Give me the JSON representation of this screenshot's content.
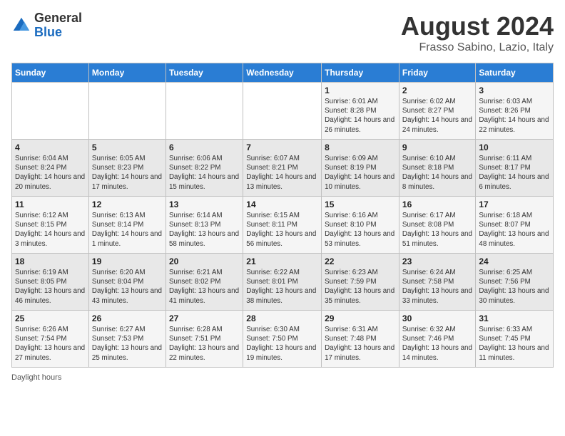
{
  "header": {
    "logo_general": "General",
    "logo_blue": "Blue",
    "month_title": "August 2024",
    "location": "Frasso Sabino, Lazio, Italy"
  },
  "weekdays": [
    "Sunday",
    "Monday",
    "Tuesday",
    "Wednesday",
    "Thursday",
    "Friday",
    "Saturday"
  ],
  "footer": {
    "daylight_note": "Daylight hours"
  },
  "weeks": [
    [
      {
        "day": "",
        "info": ""
      },
      {
        "day": "",
        "info": ""
      },
      {
        "day": "",
        "info": ""
      },
      {
        "day": "",
        "info": ""
      },
      {
        "day": "1",
        "info": "Sunrise: 6:01 AM\nSunset: 8:28 PM\nDaylight: 14 hours and 26 minutes."
      },
      {
        "day": "2",
        "info": "Sunrise: 6:02 AM\nSunset: 8:27 PM\nDaylight: 14 hours and 24 minutes."
      },
      {
        "day": "3",
        "info": "Sunrise: 6:03 AM\nSunset: 8:26 PM\nDaylight: 14 hours and 22 minutes."
      }
    ],
    [
      {
        "day": "4",
        "info": "Sunrise: 6:04 AM\nSunset: 8:24 PM\nDaylight: 14 hours and 20 minutes."
      },
      {
        "day": "5",
        "info": "Sunrise: 6:05 AM\nSunset: 8:23 PM\nDaylight: 14 hours and 17 minutes."
      },
      {
        "day": "6",
        "info": "Sunrise: 6:06 AM\nSunset: 8:22 PM\nDaylight: 14 hours and 15 minutes."
      },
      {
        "day": "7",
        "info": "Sunrise: 6:07 AM\nSunset: 8:21 PM\nDaylight: 14 hours and 13 minutes."
      },
      {
        "day": "8",
        "info": "Sunrise: 6:09 AM\nSunset: 8:19 PM\nDaylight: 14 hours and 10 minutes."
      },
      {
        "day": "9",
        "info": "Sunrise: 6:10 AM\nSunset: 8:18 PM\nDaylight: 14 hours and 8 minutes."
      },
      {
        "day": "10",
        "info": "Sunrise: 6:11 AM\nSunset: 8:17 PM\nDaylight: 14 hours and 6 minutes."
      }
    ],
    [
      {
        "day": "11",
        "info": "Sunrise: 6:12 AM\nSunset: 8:15 PM\nDaylight: 14 hours and 3 minutes."
      },
      {
        "day": "12",
        "info": "Sunrise: 6:13 AM\nSunset: 8:14 PM\nDaylight: 14 hours and 1 minute."
      },
      {
        "day": "13",
        "info": "Sunrise: 6:14 AM\nSunset: 8:13 PM\nDaylight: 13 hours and 58 minutes."
      },
      {
        "day": "14",
        "info": "Sunrise: 6:15 AM\nSunset: 8:11 PM\nDaylight: 13 hours and 56 minutes."
      },
      {
        "day": "15",
        "info": "Sunrise: 6:16 AM\nSunset: 8:10 PM\nDaylight: 13 hours and 53 minutes."
      },
      {
        "day": "16",
        "info": "Sunrise: 6:17 AM\nSunset: 8:08 PM\nDaylight: 13 hours and 51 minutes."
      },
      {
        "day": "17",
        "info": "Sunrise: 6:18 AM\nSunset: 8:07 PM\nDaylight: 13 hours and 48 minutes."
      }
    ],
    [
      {
        "day": "18",
        "info": "Sunrise: 6:19 AM\nSunset: 8:05 PM\nDaylight: 13 hours and 46 minutes."
      },
      {
        "day": "19",
        "info": "Sunrise: 6:20 AM\nSunset: 8:04 PM\nDaylight: 13 hours and 43 minutes."
      },
      {
        "day": "20",
        "info": "Sunrise: 6:21 AM\nSunset: 8:02 PM\nDaylight: 13 hours and 41 minutes."
      },
      {
        "day": "21",
        "info": "Sunrise: 6:22 AM\nSunset: 8:01 PM\nDaylight: 13 hours and 38 minutes."
      },
      {
        "day": "22",
        "info": "Sunrise: 6:23 AM\nSunset: 7:59 PM\nDaylight: 13 hours and 35 minutes."
      },
      {
        "day": "23",
        "info": "Sunrise: 6:24 AM\nSunset: 7:58 PM\nDaylight: 13 hours and 33 minutes."
      },
      {
        "day": "24",
        "info": "Sunrise: 6:25 AM\nSunset: 7:56 PM\nDaylight: 13 hours and 30 minutes."
      }
    ],
    [
      {
        "day": "25",
        "info": "Sunrise: 6:26 AM\nSunset: 7:54 PM\nDaylight: 13 hours and 27 minutes."
      },
      {
        "day": "26",
        "info": "Sunrise: 6:27 AM\nSunset: 7:53 PM\nDaylight: 13 hours and 25 minutes."
      },
      {
        "day": "27",
        "info": "Sunrise: 6:28 AM\nSunset: 7:51 PM\nDaylight: 13 hours and 22 minutes."
      },
      {
        "day": "28",
        "info": "Sunrise: 6:30 AM\nSunset: 7:50 PM\nDaylight: 13 hours and 19 minutes."
      },
      {
        "day": "29",
        "info": "Sunrise: 6:31 AM\nSunset: 7:48 PM\nDaylight: 13 hours and 17 minutes."
      },
      {
        "day": "30",
        "info": "Sunrise: 6:32 AM\nSunset: 7:46 PM\nDaylight: 13 hours and 14 minutes."
      },
      {
        "day": "31",
        "info": "Sunrise: 6:33 AM\nSunset: 7:45 PM\nDaylight: 13 hours and 11 minutes."
      }
    ]
  ]
}
